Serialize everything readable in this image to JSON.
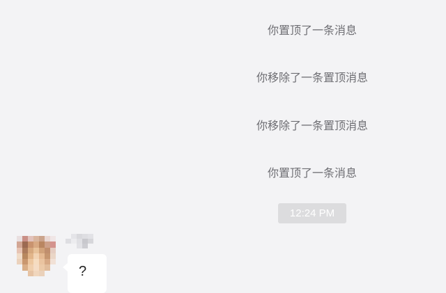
{
  "system_messages": [
    "你置顶了一条消息",
    "你移除了一条置顶消息",
    "你移除了一条置顶消息",
    "你置顶了一条消息"
  ],
  "timestamp": "12:24 PM",
  "message": {
    "text": "?"
  },
  "colors": {
    "background": "#f3f3f5",
    "system_text": "#6e6e73",
    "timestamp_bg": "#dcdcde",
    "bubble_bg": "#ffffff"
  }
}
